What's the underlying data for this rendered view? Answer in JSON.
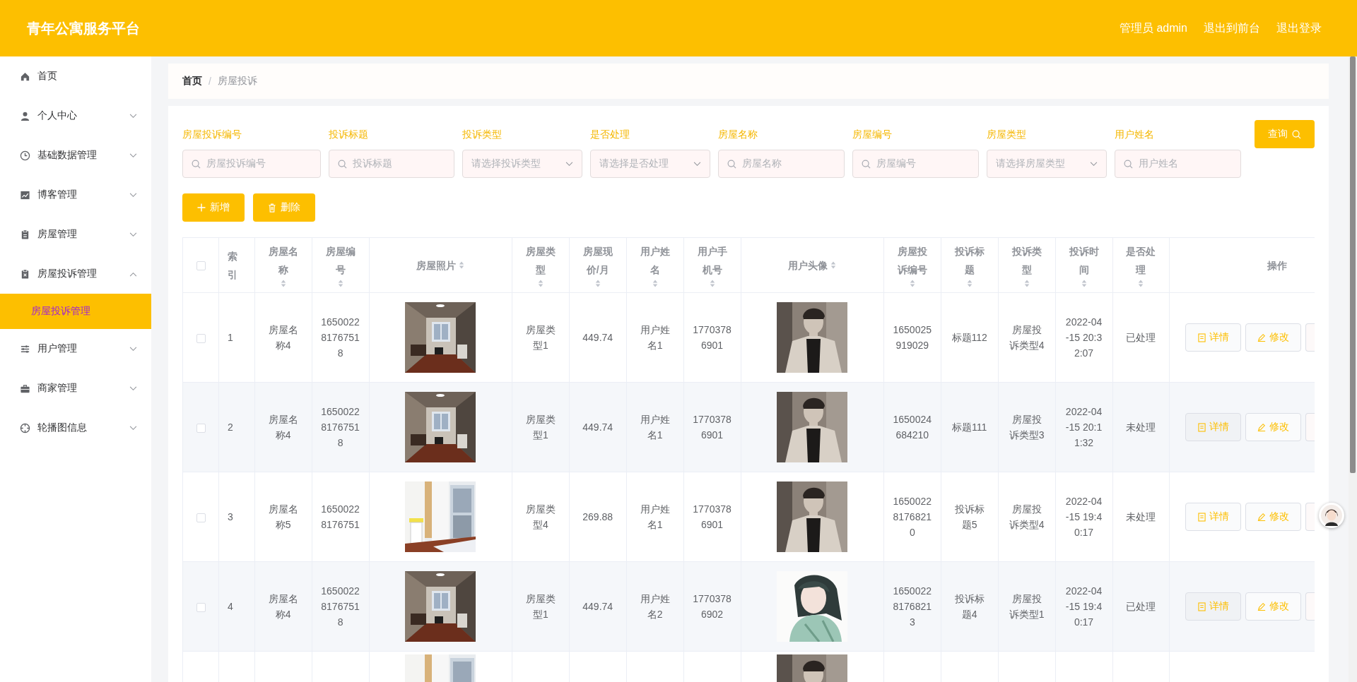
{
  "header": {
    "title": "青年公寓服务平台",
    "links": [
      "管理员 admin",
      "退出到前台",
      "退出登录"
    ]
  },
  "sidebar": {
    "items": [
      {
        "label": "首页",
        "kind": "home",
        "expandable": false
      },
      {
        "label": "个人中心",
        "kind": "user",
        "expandable": true,
        "expanded": false
      },
      {
        "label": "基础数据管理",
        "kind": "clock",
        "expandable": true,
        "expanded": false
      },
      {
        "label": "博客管理",
        "kind": "chart",
        "expandable": true,
        "expanded": false
      },
      {
        "label": "房屋管理",
        "kind": "clipboard",
        "expandable": true,
        "expanded": false
      },
      {
        "label": "房屋投诉管理",
        "kind": "complaint",
        "expandable": true,
        "expanded": true,
        "children": [
          {
            "label": "房屋投诉管理",
            "selected": true
          }
        ]
      },
      {
        "label": "用户管理",
        "kind": "sliders",
        "expandable": true,
        "expanded": false
      },
      {
        "label": "商家管理",
        "kind": "briefcase",
        "expandable": true,
        "expanded": false
      },
      {
        "label": "轮播图信息",
        "kind": "compass",
        "expandable": true,
        "expanded": false
      }
    ]
  },
  "breadcrumb": {
    "items": [
      "首页",
      "房屋投诉"
    ],
    "separator": "/"
  },
  "filters": [
    {
      "label": "房屋投诉编号",
      "kind": "text",
      "placeholder": "房屋投诉编号"
    },
    {
      "label": "投诉标题",
      "kind": "text",
      "placeholder": "投诉标题"
    },
    {
      "label": "投诉类型",
      "kind": "select",
      "placeholder": "请选择投诉类型"
    },
    {
      "label": "是否处理",
      "kind": "select",
      "placeholder": "请选择是否处理"
    },
    {
      "label": "房屋名称",
      "kind": "text",
      "placeholder": "房屋名称"
    },
    {
      "label": "房屋编号",
      "kind": "text",
      "placeholder": "房屋编号"
    },
    {
      "label": "房屋类型",
      "kind": "select",
      "placeholder": "请选择房屋类型"
    },
    {
      "label": "用户姓名",
      "kind": "text",
      "placeholder": "用户姓名"
    }
  ],
  "search_button": "查询",
  "actions": [
    {
      "label": "新增",
      "kind": "add"
    },
    {
      "label": "删除",
      "kind": "delete"
    }
  ],
  "table": {
    "select_all": {
      "checked": false
    },
    "columns": [
      {
        "label": "索引",
        "sortable": false
      },
      {
        "label": "房屋名称",
        "sortable": true
      },
      {
        "label": "房屋编号",
        "sortable": true
      },
      {
        "label": "房屋照片",
        "sortable": true
      },
      {
        "label": "房屋类型",
        "sortable": true
      },
      {
        "label": "房屋现价/月",
        "sortable": true
      },
      {
        "label": "用户姓名",
        "sortable": true
      },
      {
        "label": "用户手机号",
        "sortable": true
      },
      {
        "label": "用户头像",
        "sortable": true
      },
      {
        "label": "房屋投诉编号",
        "sortable": true
      },
      {
        "label": "投诉标题",
        "sortable": true
      },
      {
        "label": "投诉类型",
        "sortable": true
      },
      {
        "label": "投诉时间",
        "sortable": true
      },
      {
        "label": "是否处理",
        "sortable": true
      },
      {
        "label": "操作",
        "sortable": false
      }
    ],
    "rows": [
      {
        "checked": false,
        "index": "1",
        "house_name": "房屋名称4",
        "house_no": "165002281767518",
        "photo": {
          "kind": "picture"
        },
        "house_type": "房屋类型1",
        "price": "449.74",
        "user_name": "用户姓名1",
        "phone": "17703786901",
        "avatar": {
          "kind": "picture"
        },
        "complaint_no": "1650025919029",
        "complaint_title": "标题112",
        "complaint_type": "房屋投诉类型4",
        "complaint_time": "2022-04-15 20:32:07",
        "handled": "已处理",
        "buttons": [
          {
            "label": "详情",
            "kind": "detail"
          },
          {
            "label": "修改",
            "kind": "edit"
          }
        ]
      },
      {
        "checked": false,
        "index": "2",
        "house_name": "房屋名称4",
        "house_no": "165002281767518",
        "photo": {
          "kind": "picture"
        },
        "house_type": "房屋类型1",
        "price": "449.74",
        "user_name": "用户姓名1",
        "phone": "17703786901",
        "avatar": {
          "kind": "picture"
        },
        "complaint_no": "1650024684210",
        "complaint_title": "标题111",
        "complaint_type": "房屋投诉类型3",
        "complaint_time": "2022-04-15 20:11:32",
        "handled": "未处理",
        "buttons": [
          {
            "label": "详情",
            "kind": "detail"
          },
          {
            "label": "修改",
            "kind": "edit"
          }
        ]
      },
      {
        "checked": false,
        "index": "3",
        "house_name": "房屋名称5",
        "house_no": "16500228176751",
        "photo": {
          "kind": "picture"
        },
        "house_type": "房屋类型4",
        "price": "269.88",
        "user_name": "用户姓名1",
        "phone": "17703786901",
        "avatar": {
          "kind": "picture"
        },
        "complaint_no": "165002281768210",
        "complaint_title": "投诉标题5",
        "complaint_type": "房屋投诉类型4",
        "complaint_time": "2022-04-15 19:40:17",
        "handled": "未处理",
        "buttons": [
          {
            "label": "详情",
            "kind": "detail"
          },
          {
            "label": "修改",
            "kind": "edit"
          }
        ]
      },
      {
        "checked": false,
        "index": "4",
        "house_name": "房屋名称4",
        "house_no": "165002281767518",
        "photo": {
          "kind": "picture"
        },
        "house_type": "房屋类型1",
        "price": "449.74",
        "user_name": "用户姓名2",
        "phone": "17703786902",
        "avatar": {
          "kind": "picture"
        },
        "complaint_no": "165002281768213",
        "complaint_title": "投诉标题4",
        "complaint_type": "房屋投诉类型1",
        "complaint_time": "2022-04-15 19:40:17",
        "handled": "已处理",
        "buttons": [
          {
            "label": "详情",
            "kind": "detail"
          },
          {
            "label": "修改",
            "kind": "edit"
          }
        ]
      }
    ],
    "cut_row": {
      "photo": {
        "kind": "picture"
      },
      "avatar": {
        "kind": "picture"
      }
    }
  }
}
